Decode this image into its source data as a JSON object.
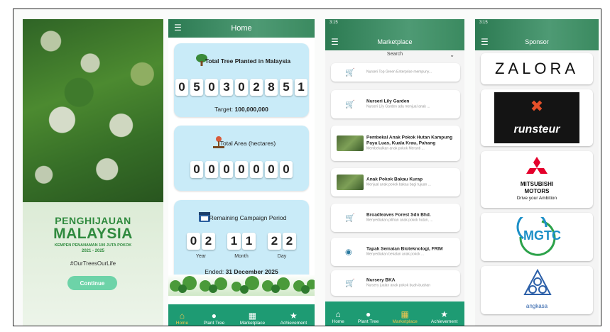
{
  "screen1": {
    "title_line1": "PENGHIJAUAN",
    "title_line2": "MALAYSIA",
    "subtitle": "KEMPEN PENANAMAN 100 JUTA POKOK",
    "years": "2021 - 2025",
    "hashtag": "#OurTreesOurLife",
    "continue_label": "Continue"
  },
  "home": {
    "title": "Home",
    "total_tree_title": "Total Tree Planted in Malaysia",
    "total_tree_digits": [
      "0",
      "5",
      "0",
      "3",
      "0",
      "2",
      "8",
      "5",
      "1"
    ],
    "target_label": "Target:",
    "target_value": "100,000,000",
    "area_title": "Total Area (hectares)",
    "area_digits": [
      "0",
      "0",
      "0",
      "0",
      "0",
      "0",
      "0"
    ],
    "period_title": "Remaining Campaign Period",
    "year_digits": [
      "0",
      "2"
    ],
    "month_digits": [
      "1",
      "1"
    ],
    "day_digits": [
      "2",
      "2"
    ],
    "year_label": "Year",
    "month_label": "Month",
    "day_label": "Day",
    "ended_label": "Ended:",
    "ended_value": "31 December 2025"
  },
  "nav": {
    "home": "Home",
    "plant_tree": "Plant Tree",
    "marketplace": "Marketplace",
    "achievement": "Achievement"
  },
  "marketplace": {
    "status_time": "3:15",
    "title": "Marketplace",
    "search_label": "Search",
    "items": [
      {
        "name": "",
        "desc": "Nurseri Top Green Enterprise mempuny..."
      },
      {
        "name": "Nurseri Lily Garden",
        "desc": "Nurseri Lily Garden ada menjual anak ..."
      },
      {
        "name": "Pembekal Anak Pokok Hutan Kampung Paya Luas, Kuala Krau, Pahang",
        "desc": "Membekalkan anak pokok Meranti ..."
      },
      {
        "name": "Anak Pokok Bakau Kurap",
        "desc": "Menjual anak pokok bakau bagi tujuan ..."
      },
      {
        "name": "Broadleaves Forest Sdn Bhd.",
        "desc": "Menyediakan pilihan anak pokok hutan, ..."
      },
      {
        "name": "Tapak Semaian Bioteknologi, FRIM",
        "desc": "Menyediakan bekalan anak pokok ..."
      },
      {
        "name": "Nursery BKA",
        "desc": "Nursery jualan anak pokok buah-buahan"
      }
    ]
  },
  "sponsor": {
    "status_time": "3:15",
    "title": "Sponsor",
    "zalora": "ZALORA",
    "runsteur": "runsteur",
    "mitsubishi_line1": "MITSUBISHI",
    "mitsubishi_line2": "MOTORS",
    "mitsubishi_tagline": "Drive your Ambition",
    "mgtc": "MGTC",
    "angkasa": "angkasa"
  },
  "colors": {
    "nav_green": "#1e9b73",
    "card_blue": "#c9ebf8",
    "campaign_green": "#2f8a3e",
    "active_nav": "#f5c74e"
  }
}
